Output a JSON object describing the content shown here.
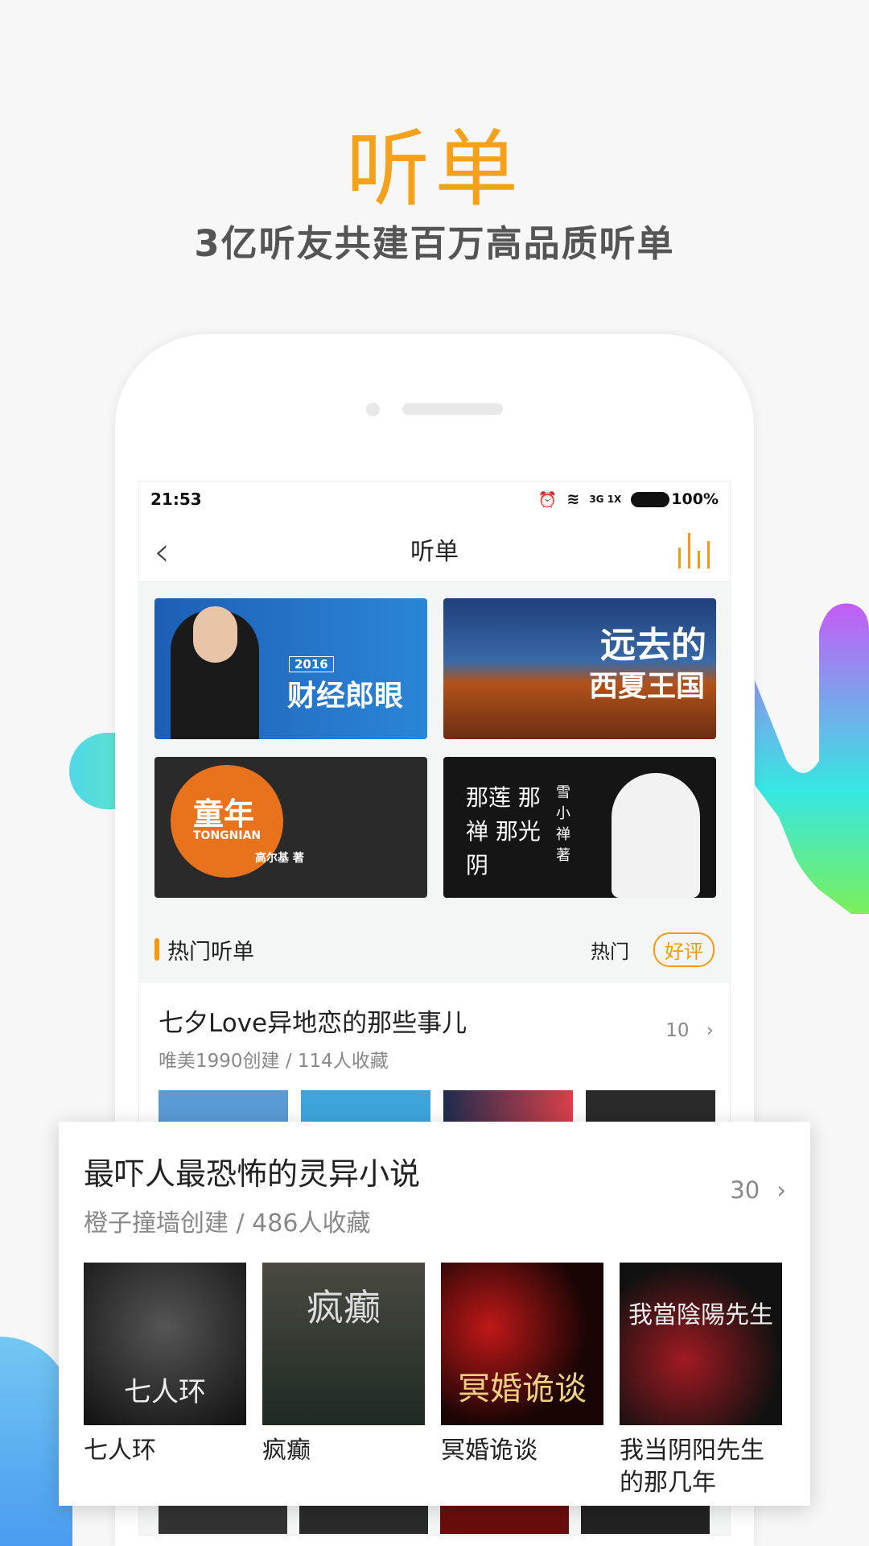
{
  "hero": {
    "title": "听单",
    "subtitle": "3亿听友共建百万高品质听单"
  },
  "status_bar": {
    "time": "21:53",
    "network": "3G 1X",
    "battery": "100%"
  },
  "nav": {
    "back_icon": "chevron-left-icon",
    "title": "听单",
    "player_icon": "equalizer-bars-icon"
  },
  "banners": [
    {
      "title": "财经郎眼",
      "year": "2016"
    },
    {
      "title": "远去的",
      "subtitle": "西夏王国"
    },
    {
      "title": "童年",
      "subtitle": "TONGNIAN",
      "author": "高尔基 著"
    },
    {
      "title": "那莲 那禅 那光阴",
      "author": "雪小禅 著"
    }
  ],
  "section": {
    "title": "热门听单",
    "tabs": [
      "热门",
      "好评"
    ],
    "active_tab": "好评"
  },
  "list": [
    {
      "title": "七夕Love异地恋的那些事儿",
      "meta": "唯美1990创建 / 114人收藏",
      "count": "10"
    }
  ],
  "featured": {
    "title": "最吓人最恐怖的灵异小说",
    "meta": "橙子撞墙创建 / 486人收藏",
    "count": "30",
    "books": [
      {
        "title": "七人环",
        "cover_text": "七人环"
      },
      {
        "title": "疯癫",
        "cover_text": "疯癫"
      },
      {
        "title": "冥婚诡谈",
        "cover_text": "冥婚诡谈"
      },
      {
        "title": "我当阴阳先生的那几年",
        "cover_text": "我當陰陽先生"
      }
    ]
  },
  "colors": {
    "accent": "#f59a0c",
    "hero_title": "#f5a11c"
  }
}
